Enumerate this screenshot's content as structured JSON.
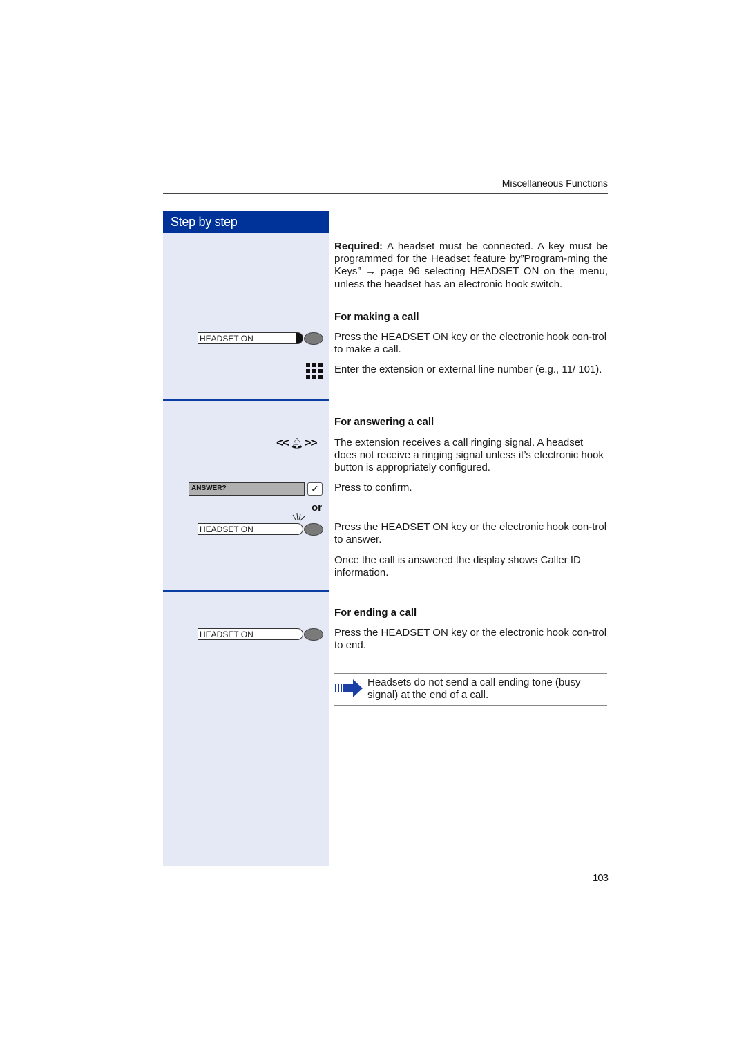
{
  "header": {
    "section_title": "Miscellaneous Functions"
  },
  "sidebar": {
    "title": "Step by step"
  },
  "intro": {
    "required_label": "Required:",
    "required_text": " A headset must be connected. A key must be programmed for the Headset feature by”Program-ming the Keys” → page 96 selecting HEADSET ON on the menu, unless the headset has an electronic hook switch."
  },
  "making_call": {
    "heading": "For making a call",
    "key_label": "HEADSET ON",
    "step1": "Press the HEADSET ON key or the electronic hook con-trol to make a call.",
    "step2": "Enter the extension or external line number (e.g., 11/ 101)."
  },
  "answering_call": {
    "heading": "For answering a call",
    "ring_left": "<<",
    "ring_right": ">>",
    "step1": "The extension receives a call ringing signal. A headset does not receive a ringing signal unless it’s electronic hook button is appropriately configured.",
    "display_label": "ANSWER?",
    "check_glyph": "✓",
    "step2": "Press to confirm.",
    "or_label": "or",
    "key_label": "HEADSET ON",
    "step3": "Press the HEADSET ON key or the electronic hook con-trol to answer.",
    "step4": "Once the call is answered the display shows Caller ID information."
  },
  "ending_call": {
    "heading": "For ending a call",
    "key_label": "HEADSET ON",
    "step1": "Press the HEADSET ON key or the electronic hook con-trol to end."
  },
  "note": {
    "icon": "note-arrow-icon",
    "text": "Headsets do not send a call ending tone (busy signal) at the end of a call."
  },
  "footer": {
    "page_number": "103"
  },
  "colors": {
    "brand_blue": "#003399",
    "sidebar_bg": "#e5e9f5",
    "led_gray": "#7a7a7a"
  }
}
